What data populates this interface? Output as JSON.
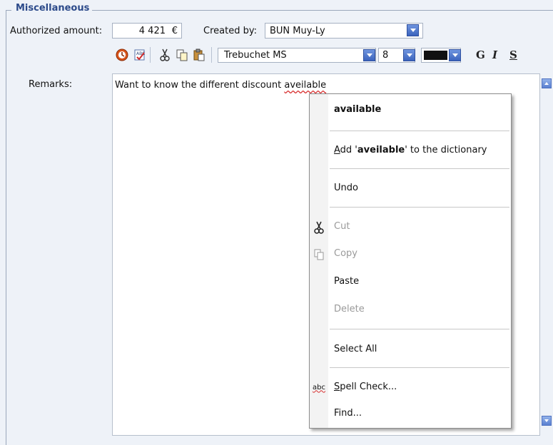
{
  "group": {
    "legend": "Miscellaneous"
  },
  "form": {
    "authorized_label": "Authorized amount:",
    "authorized_value": "4 421",
    "currency": "€",
    "created_by_label": "Created by:",
    "created_by_value": "BUN Muy-Ly"
  },
  "toolbar": {
    "font_name": "Trebuchet MS",
    "font_size": "8",
    "color": "#111111",
    "bold_label": "G",
    "italic_label": "I",
    "underline_label": "S",
    "icons": [
      "clock-icon",
      "spellcheck-icon",
      "cut-icon",
      "copy-icon",
      "paste-icon"
    ]
  },
  "remarks": {
    "label": "Remarks:",
    "text_before": "Want to know the different discount ",
    "misspelled_word": "aveilable"
  },
  "context_menu": {
    "suggestion": "available",
    "add_prefix": "dd '",
    "add_accel": "A",
    "add_word": "aveilable",
    "add_suffix": "' to the dictionary",
    "undo": "Undo",
    "cut": "Cut",
    "copy": "Copy",
    "paste": "Paste",
    "delete": "Delete",
    "select_all": "Select All",
    "spell_check_accel": "S",
    "spell_check_rest": "pell Check...",
    "find": "Find...",
    "spell_icon_text": "abc"
  }
}
